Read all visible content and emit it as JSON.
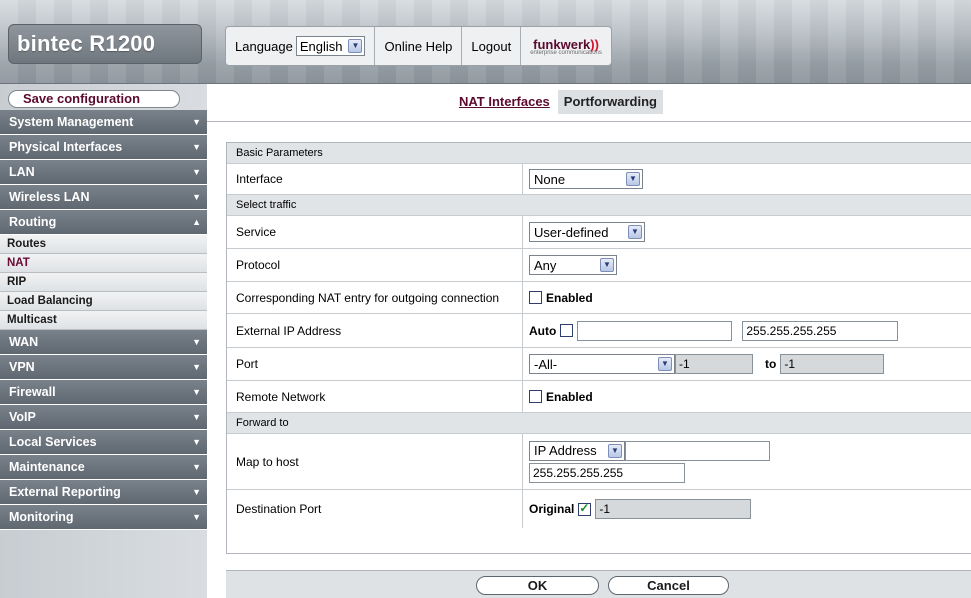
{
  "header": {
    "brand": "bintec R1200",
    "language_label": "Language",
    "language_value": "English",
    "online_help": "Online Help",
    "logout": "Logout",
    "logo_text": "funkwerk",
    "logo_sub": "enterprise communications"
  },
  "sidebar": {
    "save_label": "Save configuration",
    "items": [
      {
        "label": "System Management"
      },
      {
        "label": "Physical Interfaces"
      },
      {
        "label": "LAN"
      },
      {
        "label": "Wireless LAN"
      },
      {
        "label": "Routing"
      },
      {
        "label": "WAN"
      },
      {
        "label": "VPN"
      },
      {
        "label": "Firewall"
      },
      {
        "label": "VoIP"
      },
      {
        "label": "Local Services"
      },
      {
        "label": "Maintenance"
      },
      {
        "label": "External Reporting"
      },
      {
        "label": "Monitoring"
      }
    ],
    "routing_sub": [
      "Routes",
      "NAT",
      "RIP",
      "Load Balancing",
      "Multicast"
    ],
    "active_sub": "NAT"
  },
  "tabs": {
    "nat_interfaces": "NAT Interfaces",
    "portforwarding": "Portforwarding"
  },
  "form": {
    "basic_parameters": "Basic Parameters",
    "interface_label": "Interface",
    "interface_value": "None",
    "select_traffic": "Select traffic",
    "service_label": "Service",
    "service_value": "User-defined",
    "protocol_label": "Protocol",
    "protocol_value": "Any",
    "corresponding_label": "Corresponding NAT entry for outgoing connection",
    "enabled_label": "Enabled",
    "external_ip_label": "External IP Address",
    "auto_label": "Auto",
    "external_ip_value": "",
    "external_mask_value": "255.255.255.255",
    "port_label": "Port",
    "port_select_value": "-All-",
    "port_from_value": "-1",
    "to_label": "to",
    "port_to_value": "-1",
    "remote_network_label": "Remote Network",
    "remote_enabled_label": "Enabled",
    "forward_to": "Forward to",
    "map_to_host_label": "Map to host",
    "map_select_value": "IP Address",
    "map_ip_value": "",
    "map_mask_value": "255.255.255.255",
    "destination_port_label": "Destination Port",
    "original_label": "Original",
    "destination_port_value": "-1"
  },
  "buttons": {
    "ok": "OK",
    "cancel": "Cancel"
  }
}
